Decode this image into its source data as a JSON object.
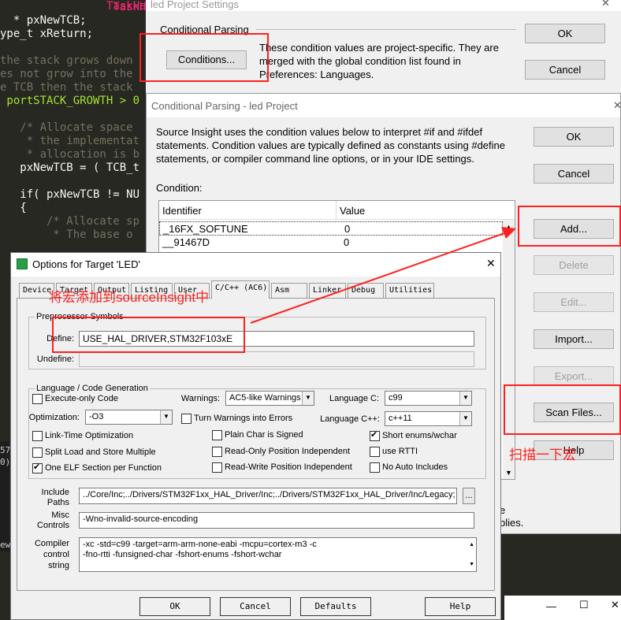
{
  "code": {
    "lines": [
      {
        "indent": "                 ",
        "text": "TaskHa",
        "cls": "kw"
      },
      {
        "indent": "  ",
        "text": "* pxNewTCB;",
        "cls": "wh"
      },
      {
        "indent": "",
        "text": "ype_t xReturn;",
        "cls": "wh"
      },
      {
        "indent": "",
        "text": "",
        "cls": "wh"
      },
      {
        "indent": "",
        "text": "the stack grows down",
        "cls": "cm"
      },
      {
        "indent": "",
        "text": "es not grow into the",
        "cls": "cm"
      },
      {
        "indent": "",
        "text": "e TCB then the stack",
        "cls": "cm"
      },
      {
        "indent": " ",
        "text": "portSTACK_GROWTH > 0",
        "cls": "gr"
      },
      {
        "indent": "",
        "text": "",
        "cls": "wh"
      },
      {
        "indent": "   ",
        "text": "/* Allocate space",
        "cls": "cm"
      },
      {
        "indent": "    ",
        "text": "* the implementat",
        "cls": "cm"
      },
      {
        "indent": "    ",
        "text": "* allocation is b",
        "cls": "cm"
      },
      {
        "indent": "   ",
        "text": "pxNewTCB = ( TCB_t",
        "cls": "wh"
      },
      {
        "indent": "",
        "text": "",
        "cls": "wh"
      },
      {
        "indent": "   ",
        "text": "if( pxNewTCB != NU",
        "cls": "wh"
      },
      {
        "indent": "   ",
        "text": "{",
        "cls": "wh"
      },
      {
        "indent": "       ",
        "text": "/* Allocate sp",
        "cls": "cm"
      },
      {
        "indent": "        ",
        "text": "* The base o",
        "cls": "cm"
      }
    ],
    "side_bits": [
      "57",
      "0",
      "0);",
      "ew"
    ]
  },
  "project_settings": {
    "title": "led Project Settings",
    "title_prefix": "TaskHa",
    "section": "Conditional Parsing",
    "conditions_button": "Conditions...",
    "description": [
      "These condition values are project-specific.  They are",
      "merged with the global condition list found in",
      "Preferences: Languages."
    ],
    "ok": "OK",
    "cancel": "Cancel"
  },
  "conditional_parsing": {
    "title": "Conditional Parsing - led Project",
    "close": "✕",
    "description": [
      "Source Insight uses the condition values below to interpret #if and #ifdef",
      "statements. Condition values are typically defined as constants using #define",
      "statements, or compiler command line options, or in your IDE settings."
    ],
    "condition_label": "Condition:",
    "columns": [
      "Identifier",
      "Value"
    ],
    "rows": [
      {
        "identifier": "_16FX_SOFTUNE",
        "value": "0"
      },
      {
        "identifier": "__91467D",
        "value": "0"
      }
    ],
    "buttons": {
      "ok": "OK",
      "cancel": "Cancel",
      "add": "Add...",
      "delete": "Delete",
      "edit": "Edit...",
      "import": "Import...",
      "export": "Export...",
      "scan": "Scan Files...",
      "help": "Help"
    },
    "bottom_text": [
      "e",
      "blies."
    ]
  },
  "options_target": {
    "title": "Options for Target 'LED'",
    "close": "✕",
    "tabs": [
      "Device",
      "Target",
      "Output",
      "Listing",
      "User",
      "C/C++ (AC6)",
      "Asm",
      "Linker",
      "Debug",
      "Utilities"
    ],
    "preprocessor_group": "Preprocessor Symbols",
    "define_label": "Define:",
    "define_value": "USE_HAL_DRIVER,STM32F103xE",
    "undefine_label": "Undefine:",
    "lang_group": "Language / Code Generation",
    "execute_only": "Execute-only Code",
    "warnings_label": "Warnings:",
    "warnings_value": "AC5-like Warnings",
    "language_c_label": "Language C:",
    "language_c_value": "c99",
    "optimization_label": "Optimization:",
    "optimization_value": "-O3",
    "turn_warnings": "Turn Warnings into Errors",
    "language_cpp_label": "Language C++:",
    "language_cpp_value": "c++11",
    "link_time": "Link-Time Optimization",
    "plain_char": "Plain Char is Signed",
    "short_enums": "Short enums/wchar",
    "split_load": "Split Load and Store Multiple",
    "read_only": "Read-Only Position Independent",
    "use_rtti": "use RTTI",
    "one_elf": "One ELF Section per Function",
    "read_write": "Read-Write Position Independent",
    "no_auto": "No Auto Includes",
    "include_label": [
      "Include",
      "Paths"
    ],
    "include_value": "../Core/Inc;../Drivers/STM32F1xx_HAL_Driver/Inc;../Drivers/STM32F1xx_HAL_Driver/Inc/Legacy;",
    "browse": "...",
    "misc_label": [
      "Misc",
      "Controls"
    ],
    "misc_value": "-Wno-invalid-source-encoding",
    "compiler_label": [
      "Compiler",
      "control",
      "string"
    ],
    "compiler_value": [
      "-xc -std=c99 -target=arm-arm-none-eabi -mcpu=cortex-m3 -c",
      "-fno-rtti -funsigned-char -fshort-enums -fshort-wchar"
    ],
    "ok": "OK",
    "cancel": "Cancel",
    "defaults": "Defaults",
    "help": "Help"
  },
  "annotations": {
    "add_macro": "将宏添加到sourceInsight中",
    "scan_macro": "扫描一下宏"
  },
  "colors": {
    "annotation": "#ff2020",
    "editor_bg": "#272822"
  }
}
